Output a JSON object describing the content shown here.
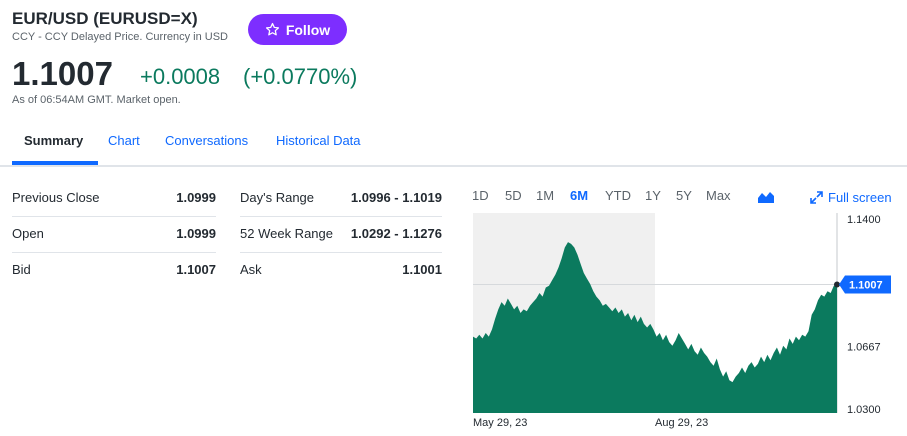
{
  "header": {
    "title": "EUR/USD (EURUSD=X)",
    "subtitle": "CCY - CCY Delayed Price. Currency in USD",
    "follow_label": "Follow",
    "price": "1.1007",
    "change": "+0.0008",
    "change_pct": "(+0.0770%)",
    "as_of": "As of 06:54AM GMT. Market open.",
    "accent_color": "#7d2eff",
    "positive_color": "#0b7a5e"
  },
  "tabs": [
    {
      "label": "Summary",
      "active": true
    },
    {
      "label": "Chart"
    },
    {
      "label": "Conversations"
    },
    {
      "label": "Historical Data"
    }
  ],
  "stats": {
    "previous_close": {
      "label": "Previous Close",
      "value": "1.0999"
    },
    "open": {
      "label": "Open",
      "value": "1.0999"
    },
    "bid": {
      "label": "Bid",
      "value": "1.1007"
    },
    "days_range": {
      "label": "Day's Range",
      "value": "1.0996 - 1.1019"
    },
    "week52_range": {
      "label": "52 Week Range",
      "value": "1.0292 - 1.1276"
    },
    "ask": {
      "label": "Ask",
      "value": "1.1001"
    }
  },
  "chart_controls": {
    "ranges": [
      "1D",
      "5D",
      "1M",
      "6M",
      "YTD",
      "1Y",
      "5Y",
      "Max"
    ],
    "active_range": "6M",
    "chart_type_icon": "mountain-chart-icon",
    "fullscreen_label": "Full screen"
  },
  "chart_data": {
    "type": "area",
    "x_tick_labels": [
      "May 29, 23",
      "Aug 29, 23"
    ],
    "y_ticks": [
      1.14,
      1.1007,
      1.0667,
      1.03
    ],
    "y_tick_labels": [
      "1.1400",
      "1.1007",
      "1.0667",
      "1.0300"
    ],
    "ylim": [
      1.03,
      1.14
    ],
    "current_price_label": "1.1007",
    "fill_color": "#0b7a5e",
    "series": [
      {
        "values": [
          1.072,
          1.071,
          1.073,
          1.071,
          1.074,
          1.072,
          1.076,
          1.082,
          1.087,
          1.091,
          1.089,
          1.093,
          1.09,
          1.087,
          1.089,
          1.085,
          1.087,
          1.086,
          1.089,
          1.091,
          1.093,
          1.096,
          1.094,
          1.099,
          1.1,
          1.103,
          1.106,
          1.11,
          1.115,
          1.121,
          1.124,
          1.123,
          1.121,
          1.117,
          1.112,
          1.107,
          1.104,
          1.101,
          1.097,
          1.094,
          1.092,
          1.089,
          1.09,
          1.088,
          1.086,
          1.088,
          1.085,
          1.087,
          1.083,
          1.085,
          1.081,
          1.084,
          1.08,
          1.083,
          1.079,
          1.077,
          1.079,
          1.076,
          1.072,
          1.074,
          1.07,
          1.073,
          1.069,
          1.067,
          1.07,
          1.074,
          1.071,
          1.068,
          1.065,
          1.068,
          1.064,
          1.062,
          1.066,
          1.063,
          1.061,
          1.058,
          1.056,
          1.06,
          1.054,
          1.05,
          1.053,
          1.048,
          1.047,
          1.05,
          1.052,
          1.055,
          1.052,
          1.056,
          1.058,
          1.055,
          1.057,
          1.061,
          1.058,
          1.062,
          1.059,
          1.063,
          1.066,
          1.062,
          1.067,
          1.065,
          1.071,
          1.068,
          1.072,
          1.07,
          1.073,
          1.072,
          1.075,
          1.084,
          1.087,
          1.092,
          1.095,
          1.094,
          1.097,
          1.096,
          1.1,
          1.1007
        ]
      }
    ]
  }
}
